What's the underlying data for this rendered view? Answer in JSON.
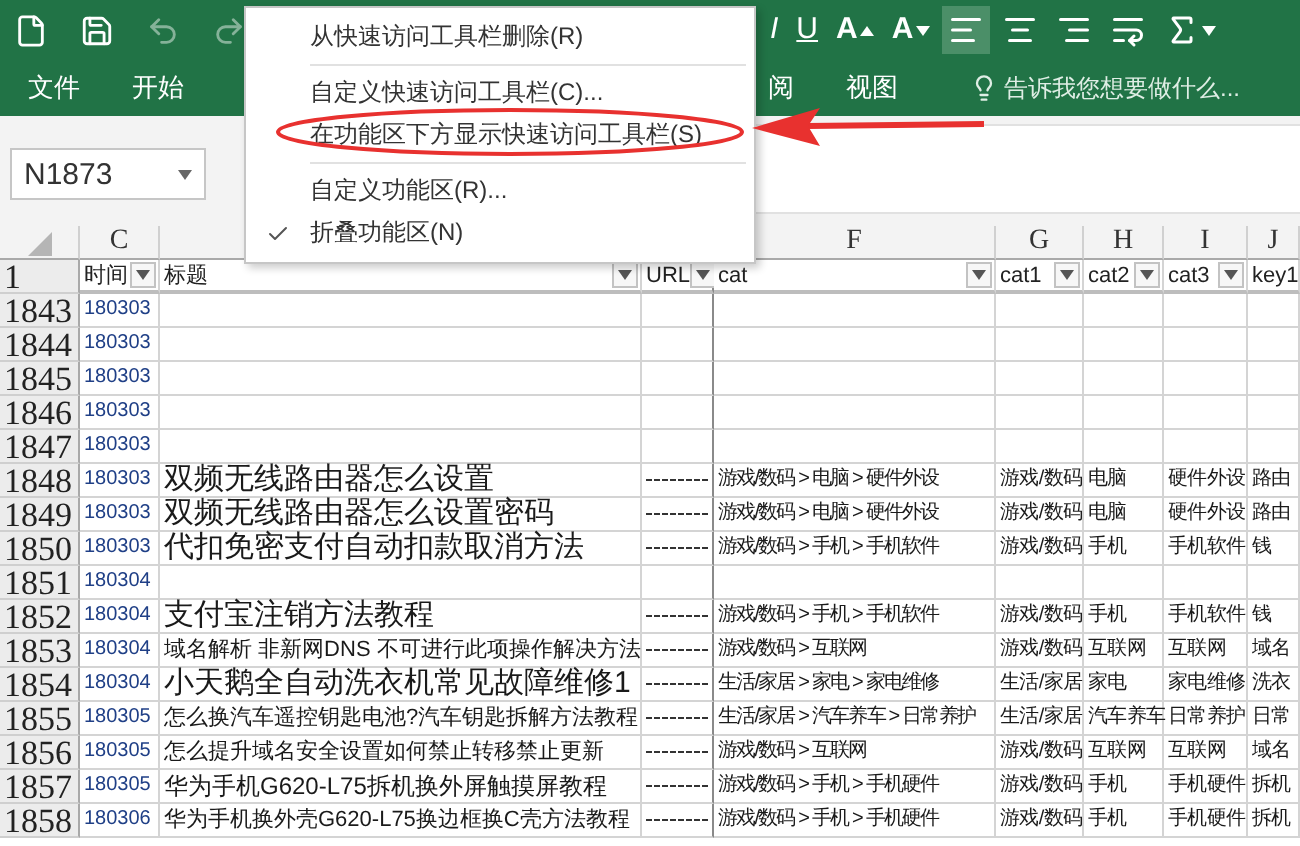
{
  "quick_access": [
    {
      "kind": "new",
      "disabled": false
    },
    {
      "kind": "save",
      "disabled": false
    },
    {
      "kind": "undo",
      "disabled": true
    },
    {
      "kind": "redo",
      "disabled": true
    }
  ],
  "ribbon_buttons": [
    {
      "kind": "italic",
      "label": "I",
      "selected": false
    },
    {
      "kind": "underline",
      "label": "U",
      "selected": false
    },
    {
      "kind": "grow",
      "label": "A",
      "selected": false
    },
    {
      "kind": "shrink",
      "label": "A",
      "selected": false
    },
    {
      "kind": "align-left",
      "selected": true
    },
    {
      "kind": "align-center",
      "selected": false
    },
    {
      "kind": "align-right",
      "selected": false
    },
    {
      "kind": "wrap",
      "selected": false
    },
    {
      "kind": "sum",
      "selected": false
    }
  ],
  "tabs_before_menu": [
    {
      "label": "文件",
      "selected": false
    },
    {
      "label": "开始",
      "selected": false
    }
  ],
  "tabs_after_menu": [
    {
      "label": "阅",
      "selected": false
    },
    {
      "label": "视图",
      "selected": false
    }
  ],
  "tell_me": {
    "placeholder": "告诉我您想要做什么..."
  },
  "name_box": {
    "value": "N1873"
  },
  "context_menu": {
    "items": [
      {
        "kind": "item",
        "label": "从快速访问工具栏删除(R)",
        "checked": false
      },
      {
        "kind": "separator"
      },
      {
        "kind": "item",
        "label": "自定义快速访问工具栏(C)...",
        "checked": false
      },
      {
        "kind": "item",
        "label": "在功能区下方显示快速访问工具栏(S)",
        "checked": false
      },
      {
        "kind": "separator"
      },
      {
        "kind": "item",
        "label": "自定义功能区(R)...",
        "checked": false
      },
      {
        "kind": "item",
        "label": "折叠功能区(N)",
        "checked": true
      }
    ]
  },
  "header_row_number": "1",
  "columns": [
    {
      "letter": "C",
      "header": "时间",
      "filter": true
    },
    {
      "header": "标题",
      "filter": true
    },
    {
      "header": "URL",
      "filter": true
    },
    {
      "letter": "F",
      "header": "cat",
      "filter": true
    },
    {
      "letter": "G",
      "header": "cat1",
      "filter": true
    },
    {
      "letter": "H",
      "header": "cat2",
      "filter": true
    },
    {
      "letter": "I",
      "header": "cat3",
      "filter": true
    },
    {
      "letter": "J",
      "header": "key1",
      "filter": false
    }
  ],
  "rows": [
    {
      "number": "1843",
      "time": "180303",
      "has_url": false
    },
    {
      "number": "1844",
      "time": "180303",
      "has_url": false
    },
    {
      "number": "1845",
      "time": "180303",
      "has_url": false
    },
    {
      "number": "1846",
      "time": "180303",
      "has_url": false
    },
    {
      "number": "1847",
      "time": "180303",
      "has_url": false
    },
    {
      "number": "1848",
      "time": "180303",
      "title": "双频无线路由器怎么设置",
      "kind": "large",
      "has_url": true,
      "cat": "游戏/数码 > 电脑 > 硬件外设",
      "cat1": "游戏/数码",
      "cat2": "电脑",
      "cat3": "硬件外设",
      "key1": "路由"
    },
    {
      "number": "1849",
      "time": "180303",
      "title": "双频无线路由器怎么设置密码",
      "kind": "large",
      "has_url": true,
      "cat": "游戏/数码 > 电脑 > 硬件外设",
      "cat1": "游戏/数码",
      "cat2": "电脑",
      "cat3": "硬件外设",
      "key1": "路由"
    },
    {
      "number": "1850",
      "time": "180303",
      "title": "代扣免密支付自动扣款取消方法",
      "kind": "large",
      "has_url": true,
      "cat": "游戏/数码 > 手机 > 手机软件",
      "cat1": "游戏/数码",
      "cat2": "手机",
      "cat3": "手机软件",
      "key1": "钱"
    },
    {
      "number": "1851",
      "time": "180304",
      "has_url": false
    },
    {
      "number": "1852",
      "time": "180304",
      "title": "支付宝注销方法教程",
      "kind": "large",
      "has_url": true,
      "cat": "游戏/数码 > 手机 > 手机软件",
      "cat1": "游戏/数码",
      "cat2": "手机",
      "cat3": "手机软件",
      "key1": "钱"
    },
    {
      "number": "1853",
      "time": "180304",
      "title": "域名解析 非新网DNS 不可进行此项操作解决方法",
      "kind": "small",
      "has_url": true,
      "cat": "游戏/数码 > 互联网",
      "cat1": "游戏/数码",
      "cat2": "互联网",
      "cat3": "互联网",
      "key1": "域名"
    },
    {
      "number": "1854",
      "time": "180304",
      "title": "小天鹅全自动洗衣机常见故障维修1",
      "kind": "large",
      "has_url": true,
      "cat": "生活/家居 > 家电 > 家电维修",
      "cat1": "生活/家居",
      "cat2": "家电",
      "cat3": "家电维修",
      "key1": "洗衣"
    },
    {
      "number": "1855",
      "time": "180305",
      "title": "怎么换汽车遥控钥匙电池?汽车钥匙拆解方法教程",
      "kind": "small",
      "has_url": true,
      "cat": "生活/家居 > 汽车养车 > 日常养护",
      "cat1": "生活/家居",
      "cat2": "汽车养车",
      "cat3": "日常养护",
      "key1": "日常"
    },
    {
      "number": "1856",
      "time": "180305",
      "title": "怎么提升域名安全设置如何禁止转移禁止更新",
      "kind": "small",
      "has_url": true,
      "cat": "游戏/数码 > 互联网",
      "cat1": "游戏/数码",
      "cat2": "互联网",
      "cat3": "互联网",
      "key1": "域名"
    },
    {
      "number": "1857",
      "time": "180305",
      "title": "华为手机G620-L75拆机换外屏触摸屏教程",
      "kind": "medium",
      "has_url": true,
      "cat": "游戏/数码 > 手机 > 手机硬件",
      "cat1": "游戏/数码",
      "cat2": "手机",
      "cat3": "手机硬件",
      "key1": "拆机"
    },
    {
      "number": "1858",
      "time": "180306",
      "title": "华为手机换外壳G620-L75换边框换C壳方法教程",
      "kind": "small",
      "has_url": true,
      "cat": "游戏/数码 > 手机 > 手机硬件",
      "cat1": "游戏/数码",
      "cat2": "手机",
      "cat3": "手机硬件",
      "key1": "拆机"
    }
  ]
}
